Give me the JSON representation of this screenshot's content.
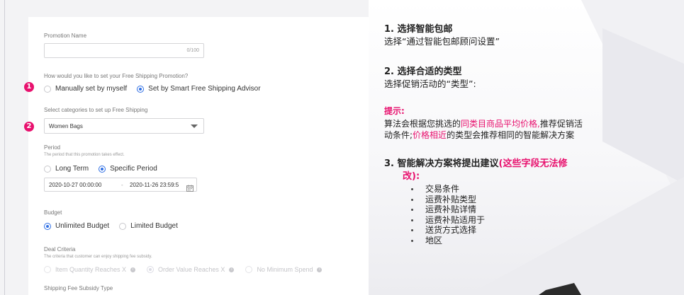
{
  "form": {
    "promotion_name": {
      "label": "Promotion Name",
      "value": "",
      "counter": "0/100"
    },
    "setup_question": "How would you like to set your Free Shipping Promotion?",
    "setup_options": [
      {
        "label": "Manually set by myself",
        "selected": false
      },
      {
        "label": "Set by Smart Free Shipping Advisor",
        "selected": true
      }
    ],
    "category": {
      "label": "Select categories to set up Free Shipping",
      "value": "Women Bags"
    },
    "period": {
      "label": "Period",
      "hint": "The period that this promotion takes effect.",
      "options": [
        {
          "label": "Long Term",
          "selected": false
        },
        {
          "label": "Specific Period",
          "selected": true
        }
      ],
      "start": "2020-10-27 00:00:00",
      "separator": "-",
      "end": "2020-11-26 23:59:5"
    },
    "budget": {
      "label": "Budget",
      "options": [
        {
          "label": "Unlimited Budget",
          "selected": true
        },
        {
          "label": "Limited Budget",
          "selected": false
        }
      ]
    },
    "deal_criteria": {
      "label": "Deal Criteria",
      "hint": "The criteria that customer can enjoy shipping fee subsidy.",
      "options": [
        {
          "label": "Item Quantity Reaches X",
          "selected": false
        },
        {
          "label": "Order Value Reaches X",
          "selected": true
        },
        {
          "label": "No Minimum Spend",
          "selected": false
        }
      ]
    },
    "subsidy_type": {
      "label": "Shipping Fee Subsidy Type"
    },
    "badges": [
      "1",
      "2"
    ]
  },
  "notes": {
    "step1_title": "1. 选择智能包邮",
    "step1_text": "选择“通过智能包邮顾问设置”",
    "step2_title": "2. 选择合适的类型",
    "step2_text": "选择促销活动的“类型”:",
    "tip_title": "提示:",
    "tip_line1": {
      "a": "算法会根据您挑选的",
      "b": "同类目商品平均价格,",
      "c": "推荐促销活"
    },
    "tip_line2": {
      "a": "动条件;",
      "b": "价格相近",
      "c": "的类型会推荐相同的智能解决方案"
    },
    "step3_title": "3. 智能解决方案将提出建议",
    "step3_note_a": "(这些字段无法修",
    "step3_note_b": "改):",
    "items": [
      "交易条件",
      "运费补贴类型",
      "运费补贴详情",
      "运费补贴适用于",
      "送货方式选择",
      "地区"
    ]
  },
  "colors": {
    "accent_blue": "#2f6fe4",
    "highlight_pink": "#e8116e"
  }
}
